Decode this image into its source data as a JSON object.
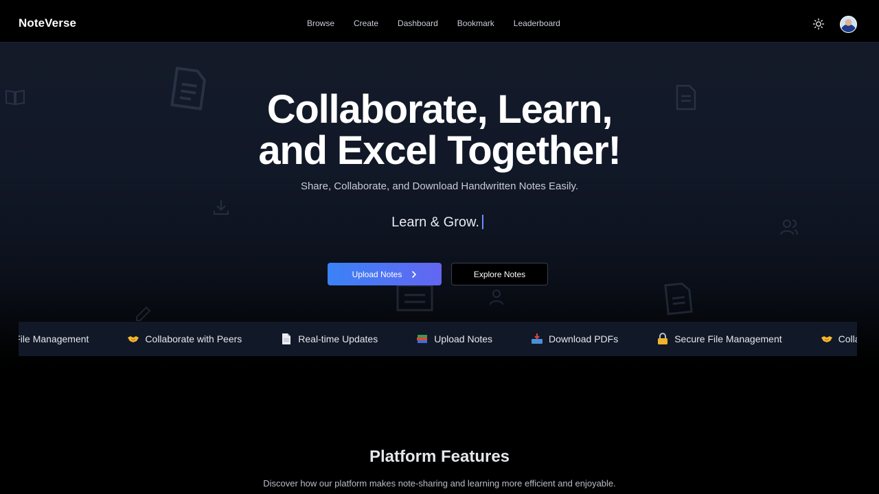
{
  "brand": "NoteVerse",
  "nav": {
    "items": [
      "Browse",
      "Create",
      "Dashboard",
      "Bookmark",
      "Leaderboard"
    ]
  },
  "hero": {
    "headline_line1": "Collaborate, Learn,",
    "headline_line2": "and Excel Together!",
    "subtitle": "Share, Collaborate, and Download Handwritten Notes Easily.",
    "typing_text": "Learn & Grow.",
    "upload_button": "Upload Notes",
    "explore_button": "Explore Notes"
  },
  "marquee": {
    "items": [
      {
        "icon": "lock-icon",
        "label": "Secure File Management"
      },
      {
        "icon": "handshake-icon",
        "label": "Collaborate with Peers"
      },
      {
        "icon": "page-icon",
        "label": "Real-time Updates"
      },
      {
        "icon": "books-icon",
        "label": "Upload Notes"
      },
      {
        "icon": "inbox-tray-icon",
        "label": "Download PDFs"
      },
      {
        "icon": "lock-icon",
        "label": "Secure File Management"
      },
      {
        "icon": "handshake-icon",
        "label": "Collaborate with Peers"
      }
    ]
  },
  "features": {
    "title": "Platform Features",
    "subtitle": "Discover how our platform makes note-sharing and learning more efficient and enjoyable."
  },
  "colors": {
    "accent_start": "#3b82f6",
    "accent_end": "#6366f1",
    "background": "#000000"
  }
}
